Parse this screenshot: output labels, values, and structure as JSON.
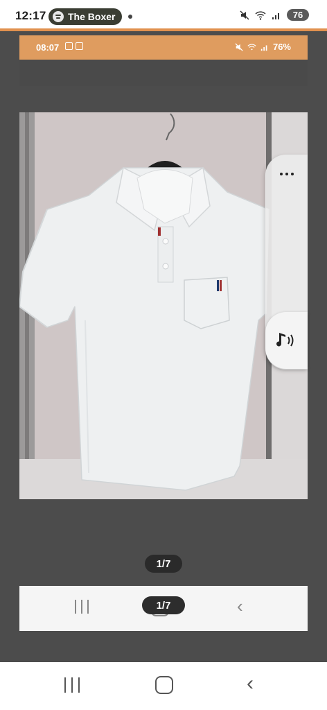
{
  "status_bar": {
    "time": "12:17",
    "now_playing": "The Boxer",
    "battery": "76",
    "icons": [
      "spotify-icon",
      "mute-icon",
      "wifi-icon",
      "signal-icon"
    ]
  },
  "inner_status_bar": {
    "time": "08:07",
    "battery_percent": "76%",
    "icons": [
      "calendar-icon",
      "gallery-icon",
      "mute-icon",
      "wifi-icon",
      "signal-icon",
      "battery-icon"
    ]
  },
  "photo": {
    "subject": "white polo shirt on hanger"
  },
  "side_panel": {
    "more_icon": "more-dots-icon",
    "audio_icon": "sound-icon"
  },
  "counter": {
    "text": "1/7"
  },
  "inner_counter": {
    "text": "1/7"
  },
  "colors": {
    "accent_orange": "#e1914f",
    "viewer_bg": "#4c4c4c",
    "pill_bg": "#3a3d33"
  }
}
